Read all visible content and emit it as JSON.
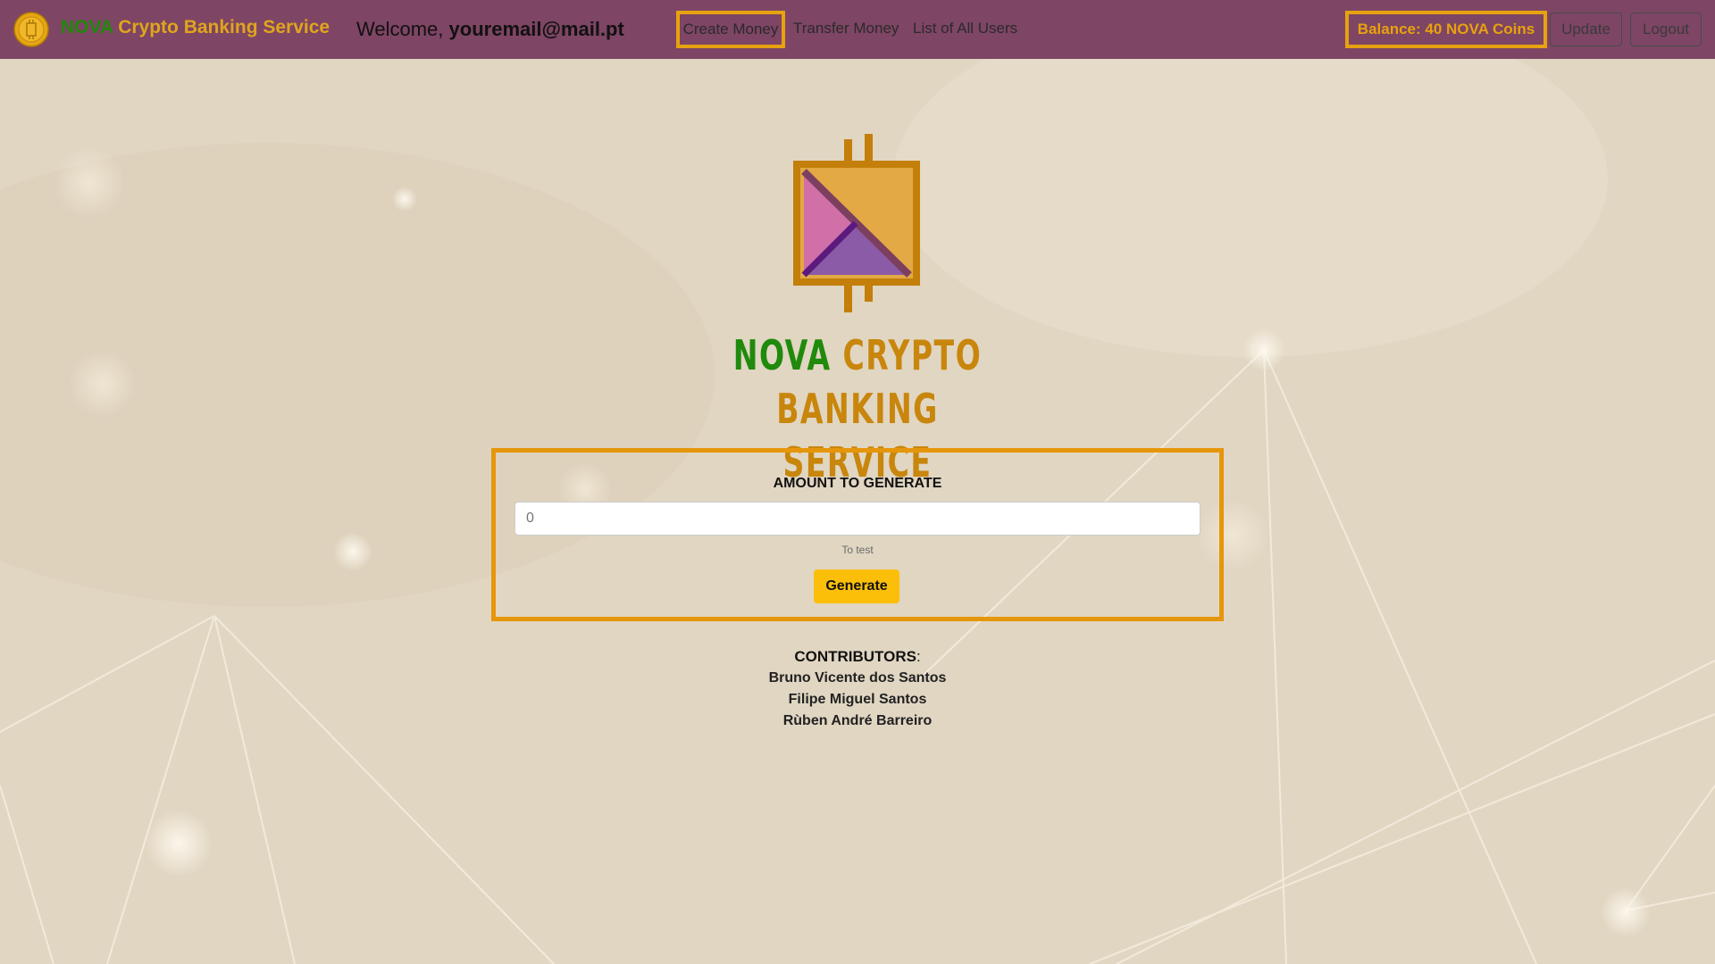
{
  "navbar": {
    "brand_part1": "NOVA",
    "brand_part2": "Crypto Banking Service",
    "welcome_prefix": "Welcome,",
    "user_email": "youremail@mail.pt",
    "links": {
      "create_money": "Create Money",
      "transfer_money": "Transfer Money",
      "list_users": "List of All Users"
    },
    "balance": "Balance: 40 NOVA Coins",
    "update_label": "Update",
    "logout_label": "Logout"
  },
  "hero": {
    "title_nova": "NOVA",
    "title_crypto": "CRYPTO",
    "title_line2": "BANKING SERVICE"
  },
  "form": {
    "label": "AMOUNT TO GENERATE",
    "amount_placeholder": "0",
    "amount_value": "",
    "help_text": "To test",
    "generate_label": "Generate"
  },
  "contributors": {
    "title": "CONTRIBUTORS",
    "separator": ":",
    "names": [
      "Bruno Vicente dos Santos",
      "Filipe Miguel Santos",
      "Rùben André Barreiro"
    ]
  },
  "colors": {
    "navbar_bg": "#7e4564",
    "accent_orange": "#e6960b",
    "brand_green": "#1f8a0b",
    "brand_gold": "#c8860c",
    "button_yellow": "#fbbf0a"
  },
  "icons": {
    "nav_logo": "coin-icon",
    "main_logo": "crypto-logo-icon"
  }
}
